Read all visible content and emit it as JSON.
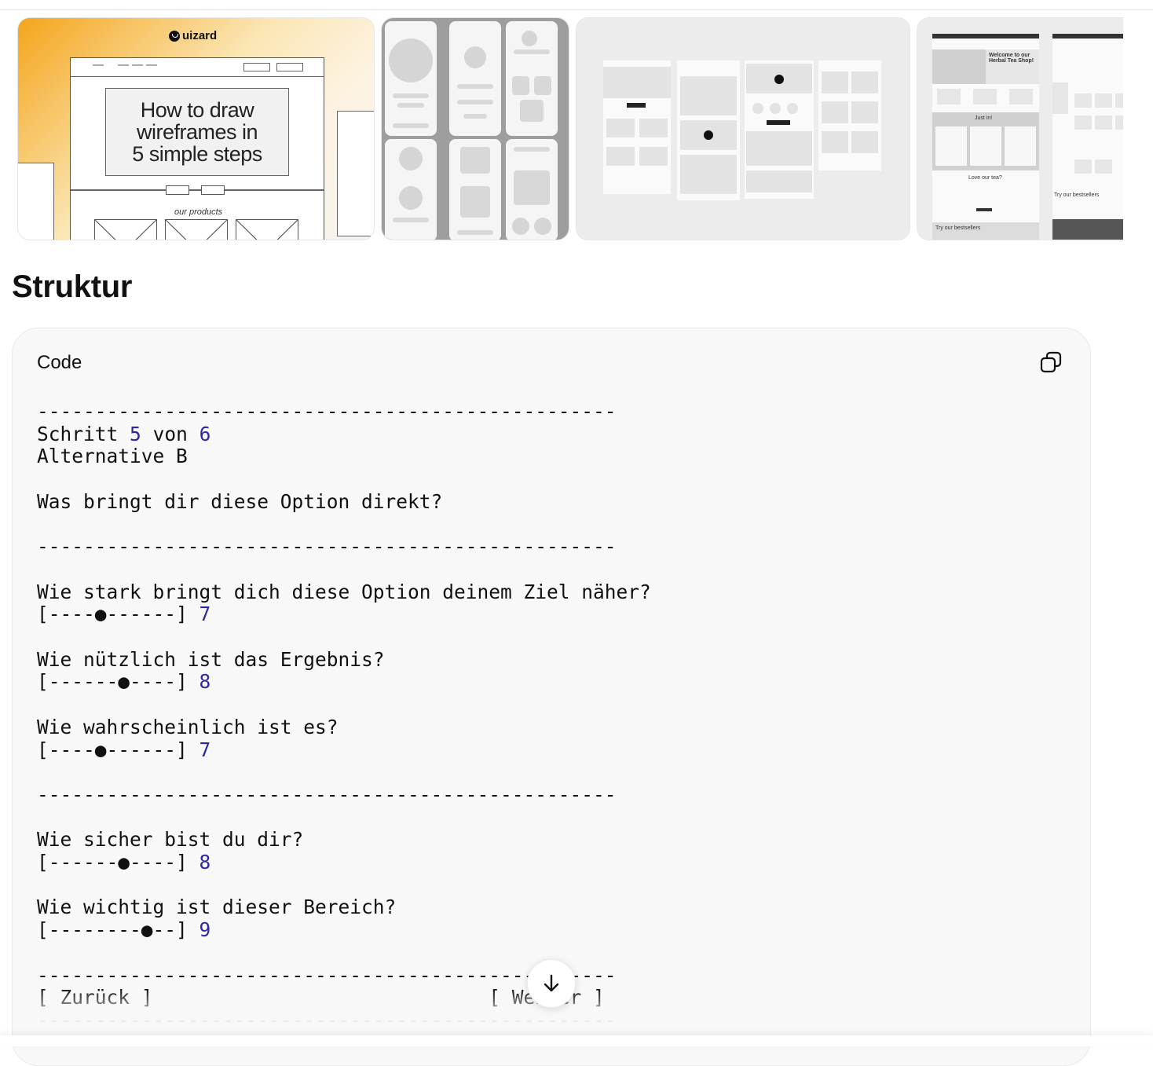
{
  "gallery": {
    "thumb1": {
      "logo": "uizard",
      "headline_line1": "How to draw",
      "headline_line2": "wireframes in",
      "headline_line3": "5 simple steps",
      "products_label": "our products"
    },
    "thumb4": {
      "welcome": "Welcome to our Herbal Tea Shop!",
      "just_in": "Just in!",
      "love_tea": "Love our tea?",
      "bestsellers": "Try our bestsellers"
    }
  },
  "section": {
    "heading": "Struktur"
  },
  "code_block": {
    "label": "Code",
    "copy_icon": "copy-icon",
    "divider": "--------------------------------------------------",
    "step_word": "Schritt",
    "step_current": "5",
    "step_of": "von",
    "step_total": "6",
    "alternative": "Alternative B",
    "question_main": "Was bringt dir diese Option direkt?",
    "ratings": [
      {
        "question": "Wie stark bringt dich diese Option deinem Ziel näher?",
        "slider": "[----●------]",
        "value": "7"
      },
      {
        "question": "Wie nützlich ist das Ergebnis?",
        "slider": "[------●----]",
        "value": "8"
      },
      {
        "question": "Wie wahrscheinlich ist es?",
        "slider": "[----●------]",
        "value": "7"
      },
      {
        "question": "Wie sicher bist du dir?",
        "slider": "[------●----]",
        "value": "8"
      },
      {
        "question": "Wie wichtig ist dieser Bereich?",
        "slider": "[--------●--]",
        "value": "9"
      }
    ],
    "back_label": "[ Zurück ]",
    "gap": "                             ",
    "next_label": "[ Weiter ]"
  },
  "scroll_button": {
    "icon": "arrow-down-icon"
  }
}
